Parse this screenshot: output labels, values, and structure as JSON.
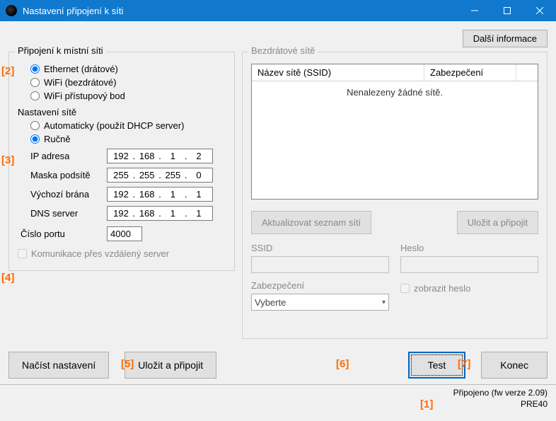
{
  "window": {
    "title": "Nastavení připojení k síti"
  },
  "topbar": {
    "more_info": "Další informace"
  },
  "lan": {
    "legend": "Připojení k místní síti",
    "ethernet": "Ethernet (drátové)",
    "wifi": "WiFi (bezdrátové)",
    "wifi_ap": "WiFi přístupový bod"
  },
  "net": {
    "legend": "Nastavení sítě",
    "auto": "Automaticky (použít DHCP server)",
    "manual": "Ručně",
    "ip_label": "IP adresa",
    "mask_label": "Maska podsítě",
    "gw_label": "Výchozí brána",
    "dns_label": "DNS server",
    "ip": {
      "a": "192",
      "b": "168",
      "c": "1",
      "d": "2"
    },
    "mask": {
      "a": "255",
      "b": "255",
      "c": "255",
      "d": "0"
    },
    "gw": {
      "a": "192",
      "b": "168",
      "c": "1",
      "d": "1"
    },
    "dns": {
      "a": "192",
      "b": "168",
      "c": "1",
      "d": "1"
    }
  },
  "port": {
    "label": "Číslo portu",
    "value": "4000"
  },
  "remote": {
    "label": "Komunikace přes vzdálený server"
  },
  "wifi": {
    "legend": "Bezdrátové sítě",
    "col_ssid": "Název sítě (SSID)",
    "col_sec": "Zabezpečení",
    "empty": "Nenalezeny žádné sítě.",
    "refresh": "Aktualizovat seznam sítí",
    "save_connect": "Uložit a připojit",
    "ssid_label": "SSID",
    "pass_label": "Heslo",
    "show_pass": "zobrazit heslo",
    "sec_label": "Zabezpečení",
    "sec_select": "Vyberte"
  },
  "bottom": {
    "load": "Načíst nastavení",
    "save": "Uložit a připojit",
    "test": "Test",
    "close": "Konec"
  },
  "status": {
    "line1": "Připojeno (fw verze 2.09)",
    "line2": "PRE40"
  },
  "refs": {
    "r1": "[1]",
    "r2": "[2]",
    "r3": "[3]",
    "r4": "[4]",
    "r5": "[5]",
    "r6": "[6]",
    "r7": "[7]"
  }
}
